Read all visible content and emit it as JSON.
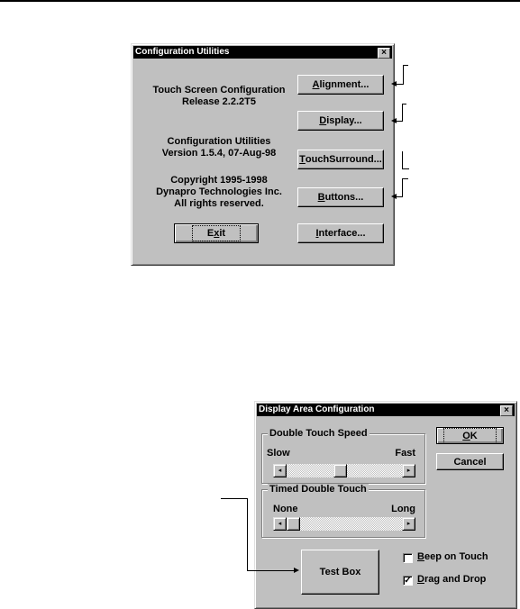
{
  "config_window": {
    "title": "Configuration Utilities",
    "close_glyph": "×",
    "info_blocks": [
      [
        "Touch Screen Configuration",
        "Release 2.2.2T5"
      ],
      [
        "Configuration Utilities",
        "Version 1.5.4, 07-Aug-98"
      ],
      [
        "Copyright 1995-1998",
        "Dynapro Technologies Inc.",
        "All rights reserved."
      ]
    ],
    "buttons": {
      "alignment": {
        "mnemonic": "A",
        "rest": "lignment..."
      },
      "display": {
        "mnemonic": "D",
        "rest": "isplay..."
      },
      "touchsurround": {
        "mnemonic": "T",
        "rest": "ouchSurround..."
      },
      "buttons": {
        "mnemonic": "B",
        "rest": "uttons..."
      },
      "exit": {
        "pre": "E",
        "mnemonic": "x",
        "rest": "it"
      },
      "interface": {
        "mnemonic": "I",
        "rest": "nterface..."
      }
    }
  },
  "display_window": {
    "title": "Display Area Configuration",
    "close_glyph": "×",
    "double_touch_speed": {
      "title": "Double Touch Speed",
      "min_label": "Slow",
      "max_label": "Fast",
      "value_fraction": 0.46
    },
    "timed_double_touch": {
      "title": "Timed Double Touch",
      "min_label": "None",
      "max_label": "Long",
      "value_fraction": 0.0
    },
    "ok": {
      "mnemonic": "O",
      "rest": "K"
    },
    "cancel_label": "Cancel",
    "test_box_label": "Test Box",
    "beep_on_touch": {
      "mnemonic": "B",
      "rest": "eep on Touch",
      "checked": false
    },
    "drag_and_drop": {
      "mnemonic": "D",
      "rest": "rag and Drop",
      "checked": true
    },
    "check_glyph": "✓",
    "arrow_left_glyph": "◂",
    "arrow_right_glyph": "▸"
  }
}
